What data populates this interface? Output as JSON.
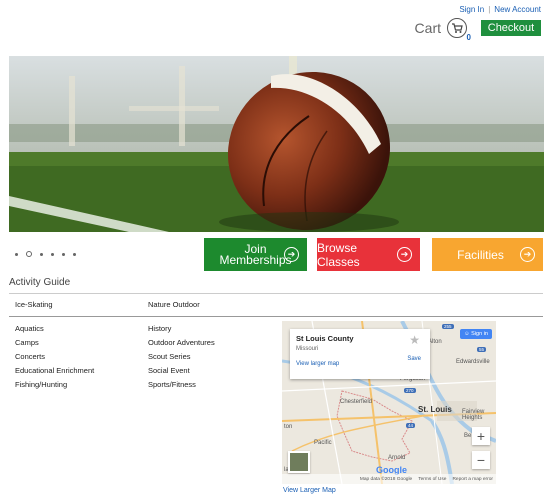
{
  "header": {
    "sign_in": "Sign In",
    "separator": "|",
    "new_account": "New Account",
    "cart_label": "Cart",
    "cart_count": "0",
    "checkout": "Checkout"
  },
  "colors": {
    "checkout": "#1f8f3e",
    "join": "#1d8a2e",
    "browse": "#e8323a",
    "facilities": "#f8a630",
    "link": "#1a5fb4"
  },
  "carousel": {
    "slide_count": 6,
    "active_slide": 2,
    "image": "football-on-field"
  },
  "cta": {
    "join_line1": "Join",
    "join_line2": "Memberships",
    "browse": "Browse Classes",
    "facilities": "Facilities"
  },
  "activity_guide": {
    "title": "Activity Guide",
    "row1": [
      "Ice-Skating",
      "Nature Outdoor"
    ],
    "col1": [
      "Aquatics",
      "Camps",
      "Concerts",
      "Educational Enrichment",
      "Fishing/Hunting"
    ],
    "col2": [
      "History",
      "Outdoor Adventures",
      "Scout Series",
      "Social Event",
      "Sports/Fitness"
    ]
  },
  "map": {
    "place_title": "St Louis County",
    "place_sub": "Missouri",
    "view_larger_inline": "View larger map",
    "save": "Save",
    "sign_in": "Sign in",
    "zoom_in": "+",
    "zoom_out": "−",
    "attribution": "Map data ©2018 Google",
    "terms": "Terms of Use",
    "report": "Report a map error",
    "google": "Google",
    "labels": {
      "alton": "Alton",
      "edwardsville": "Edwardsville",
      "ferguson": "Ferguson",
      "chesterfield": "Chesterfield",
      "st_louis": "St. Louis",
      "fairview": "Fairview Heights",
      "pacific": "Pacific",
      "arnold": "Arnold",
      "ton": "ton",
      "be": "Be",
      "lair": "lair"
    },
    "view_larger_link": "View Larger Map"
  }
}
